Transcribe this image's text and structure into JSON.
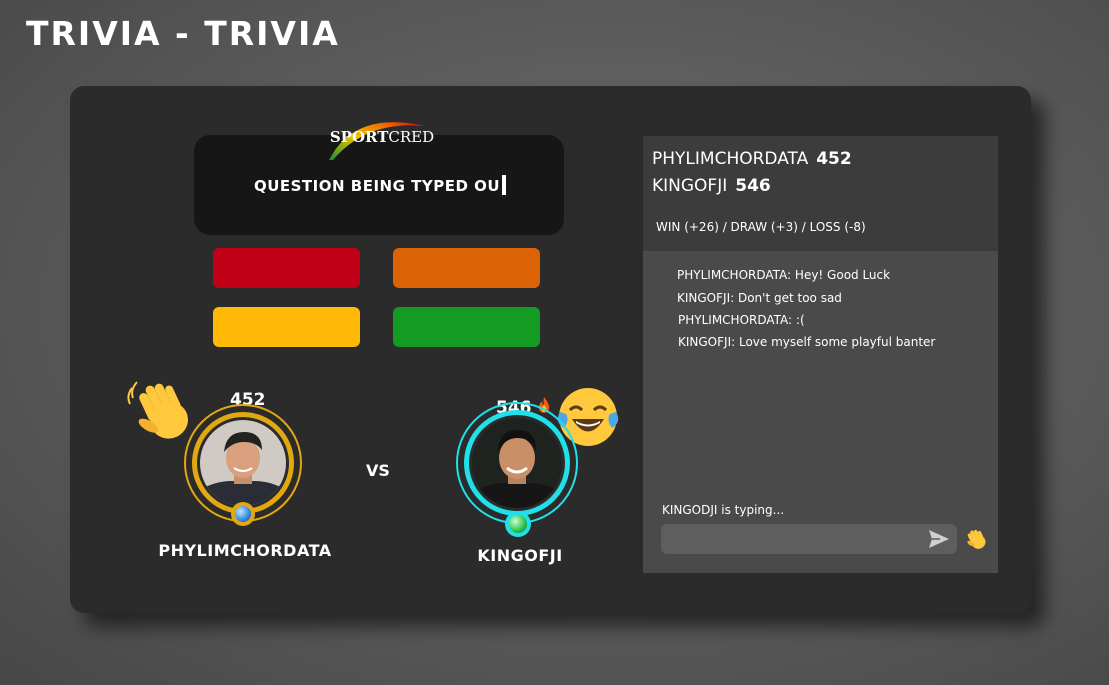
{
  "page": {
    "title": "TRIVIA - TRIVIA"
  },
  "logo": {
    "sport": "SPORT",
    "cred": "CRED"
  },
  "question": {
    "text": "QUESTION BEING TYPED OU"
  },
  "answers": [
    {
      "color": "#c00016"
    },
    {
      "color": "#db6305"
    },
    {
      "color": "#ffb906"
    },
    {
      "color": "#139b22"
    }
  ],
  "player1": {
    "name": "PHYLIMCHORDATA",
    "score": "452",
    "ring_color": "#e2a80f",
    "badge": "blue-orb",
    "emoji": "waving-hand"
  },
  "player2": {
    "name": "KINGOFJI",
    "score": "546",
    "ring_color": "#20e0e8",
    "badge": "green-orb",
    "emoji": "tears-of-joy",
    "streak_icon": "fire"
  },
  "vs_label": "VS",
  "chat": {
    "header": [
      {
        "name": "PHYLIMCHORDATA",
        "score": "452"
      },
      {
        "name": "KINGOFJI",
        "score": "546"
      }
    ],
    "rules": "WIN (+26) / DRAW (+3) / LOSS (-8)",
    "messages": [
      "PHYLIMCHORDATA: Hey! Good Luck",
      "KINGOFJI: Don't get too sad",
      "PHYLIMCHORDATA: :(",
      "KINGOFJI: Love myself some playful banter"
    ],
    "typing": "KINGODJI is typing...",
    "input_placeholder": "",
    "send_icon": "send-icon",
    "wave_icon": "waving-hand"
  }
}
